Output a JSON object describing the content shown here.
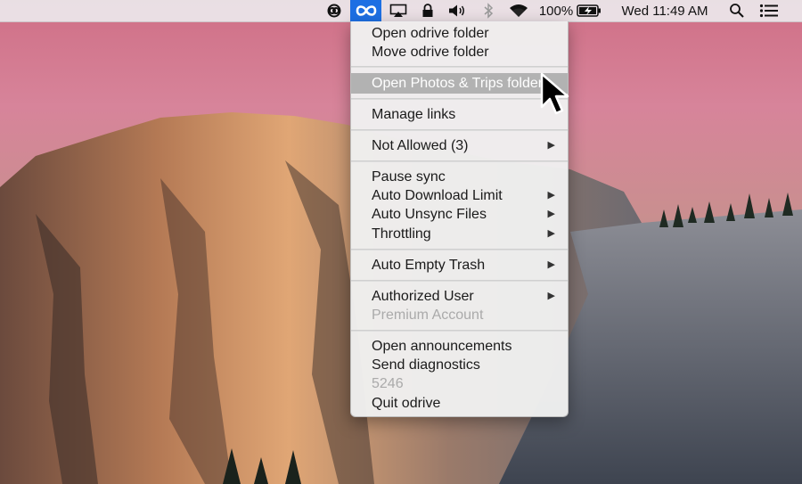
{
  "menubar": {
    "clock": "Wed 11:49 AM",
    "battery_percent": "100%",
    "icons": [
      "creative-cloud-icon",
      "odrive-icon",
      "airplay-icon",
      "lock-icon",
      "volume-icon",
      "bluetooth-icon",
      "wifi-icon",
      "battery-icon",
      "spotlight-icon",
      "notification-center-icon"
    ],
    "active_color": "#1d6fe3"
  },
  "menu": {
    "open_folder": "Open odrive folder",
    "move_folder": "Move odrive folder",
    "open_photos": "Open Photos & Trips folder",
    "manage_links": "Manage links",
    "not_allowed": "Not Allowed (3)",
    "pause_sync": "Pause sync",
    "auto_download": "Auto Download Limit",
    "auto_unsync": "Auto Unsync Files",
    "throttling": "Throttling",
    "auto_empty_trash": "Auto Empty Trash",
    "authorized_user": "Authorized User",
    "premium_account": "Premium Account",
    "open_announcements": "Open announcements",
    "send_diagnostics": "Send diagnostics",
    "version": "5246",
    "quit": "Quit odrive",
    "submenu_arrow": "▶"
  }
}
